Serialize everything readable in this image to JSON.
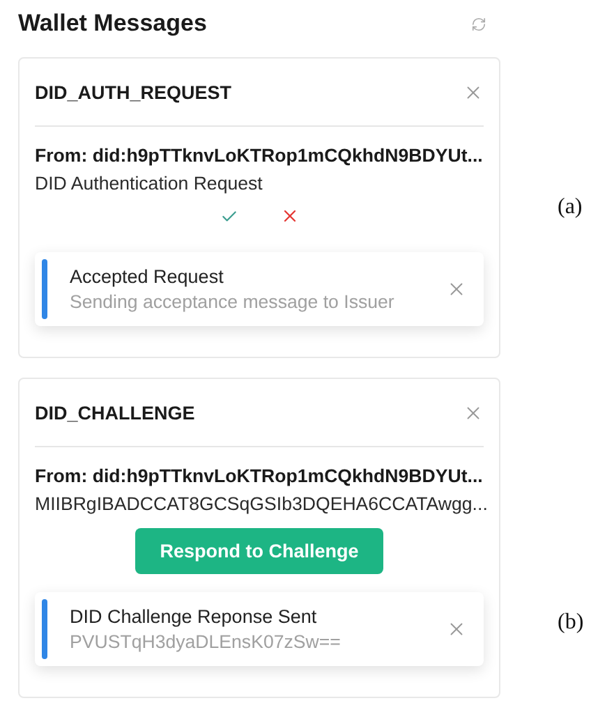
{
  "header": {
    "title": "Wallet Messages"
  },
  "messages": [
    {
      "kind": "actions",
      "type": "DID_AUTH_REQUEST",
      "from": "From: did:h9pTTknvLoKTRop1mCQkhdN9BDYUt...",
      "body": "DID Authentication Request",
      "notice": {
        "title": "Accepted Request",
        "text": "Sending acceptance message to Issuer",
        "color": "#2f86e6"
      },
      "figure_label": "(a)"
    },
    {
      "kind": "button",
      "type": "DID_CHALLENGE",
      "from": "From: did:h9pTTknvLoKTRop1mCQkhdN9BDYUt...",
      "body": "MIIBRgIBADCCAT8GCSqGSIb3DQEHA6CCATAwgg...",
      "button": "Respond to Challenge",
      "notice": {
        "title": "DID Challenge Reponse Sent",
        "text": "PVUSTqH3dyaDLEnsK07zSw==",
        "color": "#2f86e6"
      },
      "figure_label": "(b)"
    }
  ]
}
